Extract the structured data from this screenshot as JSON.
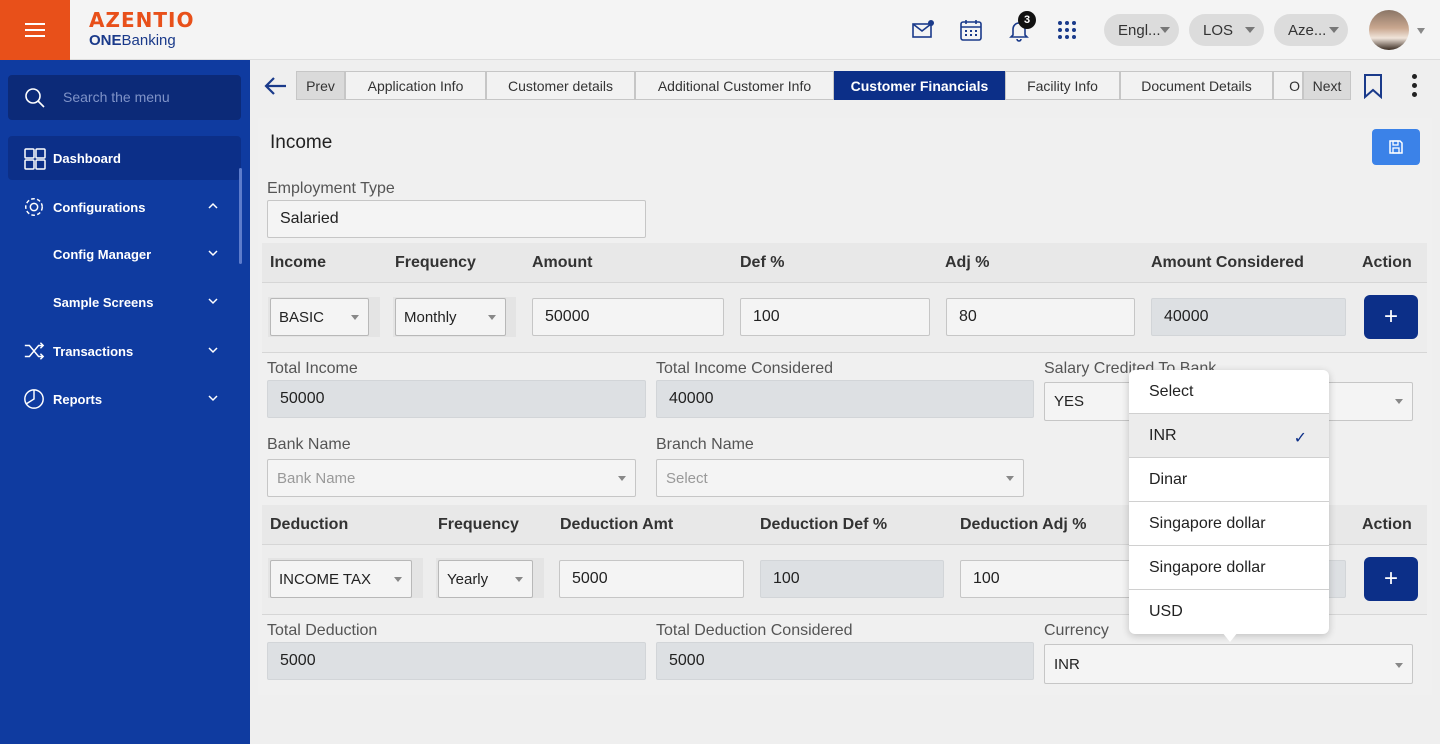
{
  "header": {
    "brand": "AZENTIO",
    "brand_sub_bold": "ONE",
    "brand_sub": "Banking",
    "notification_count": "3",
    "language": "Engl...",
    "module": "LOS",
    "user": "Aze..."
  },
  "sidebar": {
    "search_placeholder": "Search the menu",
    "items": [
      {
        "label": "Dashboard",
        "icon": "grid-icon"
      },
      {
        "label": "Configurations",
        "icon": "gear-icon"
      },
      {
        "label": "Config Manager"
      },
      {
        "label": "Sample Screens"
      },
      {
        "label": "Transactions",
        "icon": "shuffle-icon"
      },
      {
        "label": "Reports",
        "icon": "pie-chart-icon"
      }
    ]
  },
  "tabs": {
    "prev": "Prev",
    "next": "Next",
    "items": [
      "Application Info",
      "Customer details",
      "Additional Customer Info",
      "Customer Financials",
      "Facility Info",
      "Document Details",
      "O"
    ],
    "active": "Customer Financials"
  },
  "section": {
    "title": "Income"
  },
  "employment": {
    "label": "Employment Type",
    "value": "Salaried"
  },
  "income_table": {
    "headers": [
      "Income",
      "Frequency",
      "Amount",
      "Def %",
      "Adj %",
      "Amount Considered",
      "Action"
    ],
    "row": {
      "income": "BASIC",
      "frequency": "Monthly",
      "amount": "50000",
      "def": "100",
      "adj": "80",
      "considered": "40000",
      "action": "+"
    }
  },
  "totals": {
    "total_income_label": "Total Income",
    "total_income": "50000",
    "total_considered_label": "Total Income Considered",
    "total_considered": "40000",
    "salary_bank_label": "Salary Credited To Bank",
    "salary_bank": "YES"
  },
  "bank": {
    "bank_name_label": "Bank Name",
    "bank_name_placeholder": "Bank Name",
    "branch_label": "Branch Name",
    "branch_placeholder": "Select"
  },
  "deduction_table": {
    "headers": [
      "Deduction",
      "Frequency",
      "Deduction Amt",
      "Deduction Def %",
      "Deduction Adj %",
      "Action"
    ],
    "row": {
      "deduction": "INCOME TAX",
      "frequency": "Yearly",
      "amount": "5000",
      "def": "100",
      "adj": "100",
      "action": "+"
    }
  },
  "deduction_totals": {
    "total_label": "Total Deduction",
    "total": "5000",
    "considered_label": "Total Deduction Considered",
    "considered": "5000",
    "currency_label": "Currency",
    "currency": "INR"
  },
  "currency_dropdown": {
    "options": [
      "Select",
      "INR",
      "Dinar",
      "Singapore dollar",
      "Singapore dollar",
      "USD"
    ],
    "selected": "INR",
    "check": "✓"
  }
}
